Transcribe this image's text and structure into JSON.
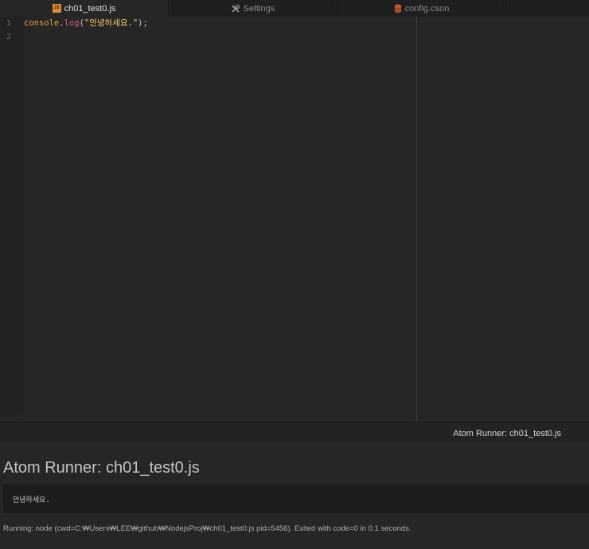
{
  "tabs": [
    {
      "label": "ch01_test0.js",
      "icon": "js-file-icon",
      "active": true
    },
    {
      "label": "Settings",
      "icon": "tools-icon",
      "active": false
    },
    {
      "label": "config.cson",
      "icon": "database-icon",
      "active": false
    }
  ],
  "editor": {
    "line_numbers": [
      "1",
      "2"
    ],
    "code": {
      "object": "console",
      "dot": ".",
      "method": "log",
      "open": "(",
      "string": "\"안녕하세요.\"",
      "close": ");"
    }
  },
  "status": {
    "title": "Atom Runner: ch01_test0.js"
  },
  "runner": {
    "title": "Atom Runner: ch01_test0.js",
    "output": "안녕하세요.",
    "footer": "Running: node (cwd=C:₩Users₩LEE₩github₩NodejsProj₩ch01_test0.js pid=5456). Exited with code=0 in 0.1 seconds."
  },
  "colors": {
    "accent_js": "#d98b2f",
    "db_icon": "#c0562f",
    "string": "#f0d060",
    "function": "#e05a7a",
    "object": "#e0a03a"
  }
}
